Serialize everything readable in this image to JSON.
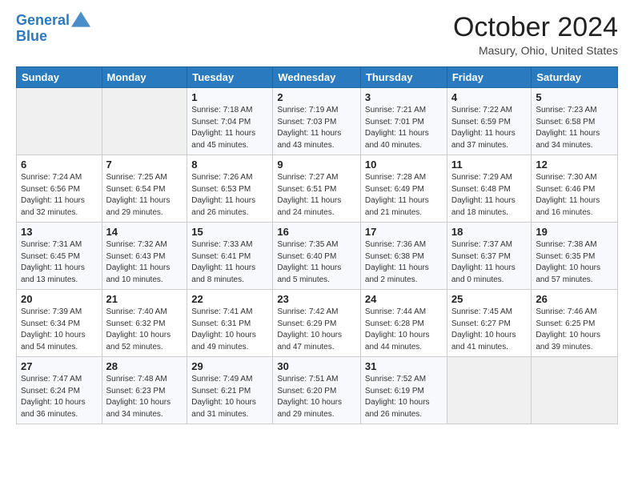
{
  "header": {
    "logo_line1": "General",
    "logo_line2": "Blue",
    "month": "October 2024",
    "location": "Masury, Ohio, United States"
  },
  "weekdays": [
    "Sunday",
    "Monday",
    "Tuesday",
    "Wednesday",
    "Thursday",
    "Friday",
    "Saturday"
  ],
  "weeks": [
    [
      {
        "day": "",
        "sunrise": "",
        "sunset": "",
        "daylight": ""
      },
      {
        "day": "",
        "sunrise": "",
        "sunset": "",
        "daylight": ""
      },
      {
        "day": "1",
        "sunrise": "Sunrise: 7:18 AM",
        "sunset": "Sunset: 7:04 PM",
        "daylight": "Daylight: 11 hours and 45 minutes."
      },
      {
        "day": "2",
        "sunrise": "Sunrise: 7:19 AM",
        "sunset": "Sunset: 7:03 PM",
        "daylight": "Daylight: 11 hours and 43 minutes."
      },
      {
        "day": "3",
        "sunrise": "Sunrise: 7:21 AM",
        "sunset": "Sunset: 7:01 PM",
        "daylight": "Daylight: 11 hours and 40 minutes."
      },
      {
        "day": "4",
        "sunrise": "Sunrise: 7:22 AM",
        "sunset": "Sunset: 6:59 PM",
        "daylight": "Daylight: 11 hours and 37 minutes."
      },
      {
        "day": "5",
        "sunrise": "Sunrise: 7:23 AM",
        "sunset": "Sunset: 6:58 PM",
        "daylight": "Daylight: 11 hours and 34 minutes."
      }
    ],
    [
      {
        "day": "6",
        "sunrise": "Sunrise: 7:24 AM",
        "sunset": "Sunset: 6:56 PM",
        "daylight": "Daylight: 11 hours and 32 minutes."
      },
      {
        "day": "7",
        "sunrise": "Sunrise: 7:25 AM",
        "sunset": "Sunset: 6:54 PM",
        "daylight": "Daylight: 11 hours and 29 minutes."
      },
      {
        "day": "8",
        "sunrise": "Sunrise: 7:26 AM",
        "sunset": "Sunset: 6:53 PM",
        "daylight": "Daylight: 11 hours and 26 minutes."
      },
      {
        "day": "9",
        "sunrise": "Sunrise: 7:27 AM",
        "sunset": "Sunset: 6:51 PM",
        "daylight": "Daylight: 11 hours and 24 minutes."
      },
      {
        "day": "10",
        "sunrise": "Sunrise: 7:28 AM",
        "sunset": "Sunset: 6:49 PM",
        "daylight": "Daylight: 11 hours and 21 minutes."
      },
      {
        "day": "11",
        "sunrise": "Sunrise: 7:29 AM",
        "sunset": "Sunset: 6:48 PM",
        "daylight": "Daylight: 11 hours and 18 minutes."
      },
      {
        "day": "12",
        "sunrise": "Sunrise: 7:30 AM",
        "sunset": "Sunset: 6:46 PM",
        "daylight": "Daylight: 11 hours and 16 minutes."
      }
    ],
    [
      {
        "day": "13",
        "sunrise": "Sunrise: 7:31 AM",
        "sunset": "Sunset: 6:45 PM",
        "daylight": "Daylight: 11 hours and 13 minutes."
      },
      {
        "day": "14",
        "sunrise": "Sunrise: 7:32 AM",
        "sunset": "Sunset: 6:43 PM",
        "daylight": "Daylight: 11 hours and 10 minutes."
      },
      {
        "day": "15",
        "sunrise": "Sunrise: 7:33 AM",
        "sunset": "Sunset: 6:41 PM",
        "daylight": "Daylight: 11 hours and 8 minutes."
      },
      {
        "day": "16",
        "sunrise": "Sunrise: 7:35 AM",
        "sunset": "Sunset: 6:40 PM",
        "daylight": "Daylight: 11 hours and 5 minutes."
      },
      {
        "day": "17",
        "sunrise": "Sunrise: 7:36 AM",
        "sunset": "Sunset: 6:38 PM",
        "daylight": "Daylight: 11 hours and 2 minutes."
      },
      {
        "day": "18",
        "sunrise": "Sunrise: 7:37 AM",
        "sunset": "Sunset: 6:37 PM",
        "daylight": "Daylight: 11 hours and 0 minutes."
      },
      {
        "day": "19",
        "sunrise": "Sunrise: 7:38 AM",
        "sunset": "Sunset: 6:35 PM",
        "daylight": "Daylight: 10 hours and 57 minutes."
      }
    ],
    [
      {
        "day": "20",
        "sunrise": "Sunrise: 7:39 AM",
        "sunset": "Sunset: 6:34 PM",
        "daylight": "Daylight: 10 hours and 54 minutes."
      },
      {
        "day": "21",
        "sunrise": "Sunrise: 7:40 AM",
        "sunset": "Sunset: 6:32 PM",
        "daylight": "Daylight: 10 hours and 52 minutes."
      },
      {
        "day": "22",
        "sunrise": "Sunrise: 7:41 AM",
        "sunset": "Sunset: 6:31 PM",
        "daylight": "Daylight: 10 hours and 49 minutes."
      },
      {
        "day": "23",
        "sunrise": "Sunrise: 7:42 AM",
        "sunset": "Sunset: 6:29 PM",
        "daylight": "Daylight: 10 hours and 47 minutes."
      },
      {
        "day": "24",
        "sunrise": "Sunrise: 7:44 AM",
        "sunset": "Sunset: 6:28 PM",
        "daylight": "Daylight: 10 hours and 44 minutes."
      },
      {
        "day": "25",
        "sunrise": "Sunrise: 7:45 AM",
        "sunset": "Sunset: 6:27 PM",
        "daylight": "Daylight: 10 hours and 41 minutes."
      },
      {
        "day": "26",
        "sunrise": "Sunrise: 7:46 AM",
        "sunset": "Sunset: 6:25 PM",
        "daylight": "Daylight: 10 hours and 39 minutes."
      }
    ],
    [
      {
        "day": "27",
        "sunrise": "Sunrise: 7:47 AM",
        "sunset": "Sunset: 6:24 PM",
        "daylight": "Daylight: 10 hours and 36 minutes."
      },
      {
        "day": "28",
        "sunrise": "Sunrise: 7:48 AM",
        "sunset": "Sunset: 6:23 PM",
        "daylight": "Daylight: 10 hours and 34 minutes."
      },
      {
        "day": "29",
        "sunrise": "Sunrise: 7:49 AM",
        "sunset": "Sunset: 6:21 PM",
        "daylight": "Daylight: 10 hours and 31 minutes."
      },
      {
        "day": "30",
        "sunrise": "Sunrise: 7:51 AM",
        "sunset": "Sunset: 6:20 PM",
        "daylight": "Daylight: 10 hours and 29 minutes."
      },
      {
        "day": "31",
        "sunrise": "Sunrise: 7:52 AM",
        "sunset": "Sunset: 6:19 PM",
        "daylight": "Daylight: 10 hours and 26 minutes."
      },
      {
        "day": "",
        "sunrise": "",
        "sunset": "",
        "daylight": ""
      },
      {
        "day": "",
        "sunrise": "",
        "sunset": "",
        "daylight": ""
      }
    ]
  ]
}
